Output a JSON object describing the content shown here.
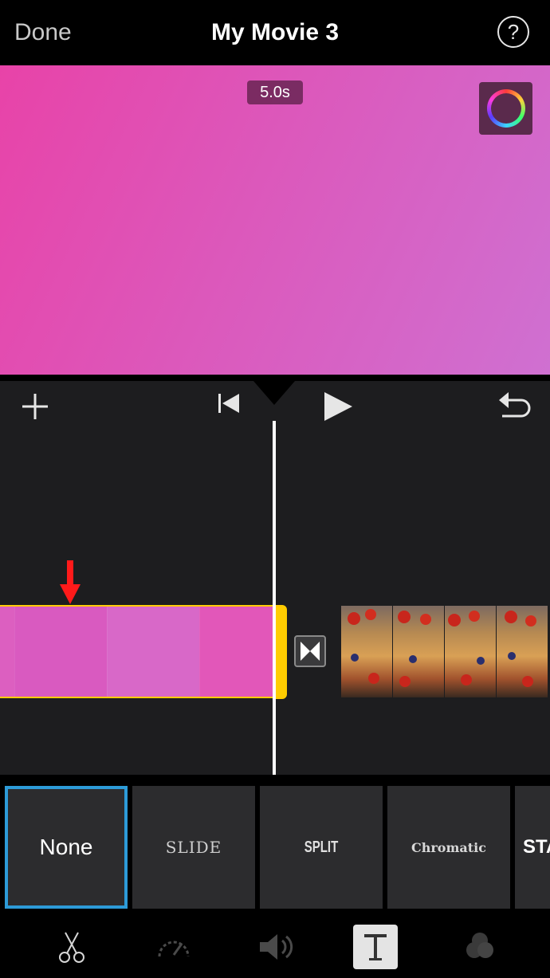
{
  "nav": {
    "done_label": "Done",
    "title": "My Movie 3",
    "help_label": "?"
  },
  "viewer": {
    "duration": "5.0s",
    "color_picker_icon": "color-wheel-icon",
    "accent": "#e24fb2"
  },
  "controls": {
    "add_icon": "plus-icon",
    "rewind_icon": "skip-to-start-icon",
    "play_icon": "play-icon",
    "undo_icon": "undo-icon"
  },
  "timeline": {
    "selected_clip_color": "#ffcc00",
    "transition_icon": "transition-icon",
    "annotation": "red-arrow"
  },
  "transitions": {
    "selected": "None",
    "items": [
      "None",
      "SLIDE",
      "SPLIT",
      "Chromatic",
      "STA"
    ],
    "selection_color": "#2d9bd8"
  },
  "toolbar": {
    "tools": [
      "scissors-icon",
      "speed-icon",
      "volume-icon",
      "text-icon",
      "filters-icon"
    ],
    "active_tool": "text-icon"
  }
}
